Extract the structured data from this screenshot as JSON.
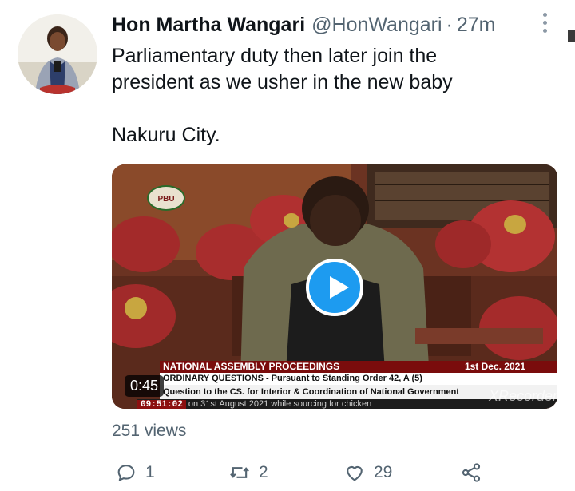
{
  "tweet": {
    "author_name": "Hon Martha Wangari",
    "handle": "@HonWangari",
    "separator": "·",
    "time": "27m",
    "text_line1": "Parliamentary duty then later join the",
    "text_line2": "president as we usher in the new baby",
    "text_line3": "Nakuru City."
  },
  "video": {
    "duration": "0:45",
    "channel_logo": "PBU",
    "ticker": {
      "title": "NATIONAL ASSEMBLY PROCEEDINGS",
      "date": "1st Dec. 2021",
      "line2": "ORDINARY QUESTIONS - Pursuant to Standing Order 42, A (5)",
      "line3": "Question to the CS. for Interior & Coordination of National Government",
      "clock": "09:51:02",
      "line4": "on 31st August 2021 while sourcing for chicken"
    },
    "watermark": "XRecorder"
  },
  "stats": {
    "views": "251 views"
  },
  "actions": {
    "reply_count": "1",
    "retweet_count": "2",
    "like_count": "29"
  },
  "icons": {
    "more": "more-vertical-icon",
    "play": "play-icon",
    "reply": "reply-icon",
    "retweet": "retweet-icon",
    "like": "heart-icon",
    "share": "share-icon"
  },
  "colors": {
    "accent": "#1d9bf0",
    "secondary_text": "#536471",
    "text": "#0f1419"
  }
}
